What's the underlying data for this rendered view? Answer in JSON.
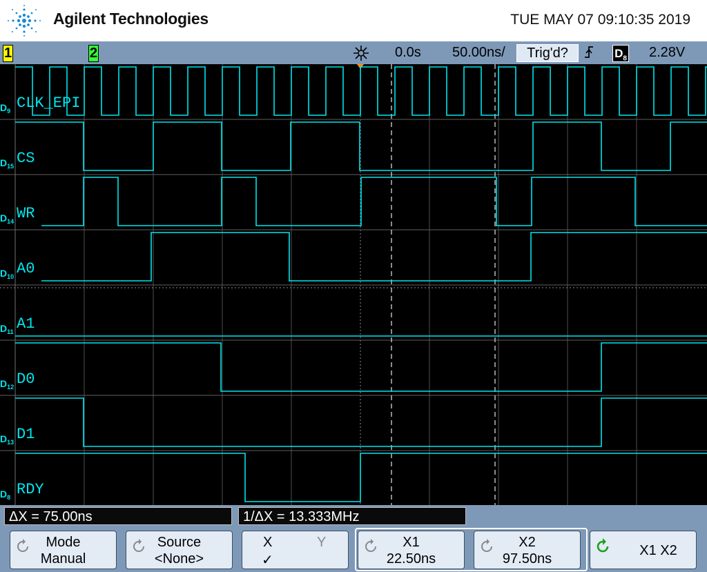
{
  "header": {
    "brand": "Agilent Technologies",
    "datetime": "TUE MAY 07 09:10:35 2019"
  },
  "statusbar": {
    "ch1": "1",
    "ch2": "2",
    "time_ref": "0.0s",
    "timebase": "50.00ns/",
    "trigger_state": "Trig'd?",
    "trigger_channel": "D",
    "trigger_channel_sub": "8",
    "trigger_level": "2.28V"
  },
  "channels": [
    {
      "label": "CLK_EPI",
      "ch": "D",
      "num": "9"
    },
    {
      "label": "CS",
      "ch": "D",
      "num": "15"
    },
    {
      "label": "WR",
      "ch": "D",
      "num": "14"
    },
    {
      "label": "A0",
      "ch": "D",
      "num": "10"
    },
    {
      "label": "A1",
      "ch": "D",
      "num": "11"
    },
    {
      "label": "D0",
      "ch": "D",
      "num": "12"
    },
    {
      "label": "D1",
      "ch": "D",
      "num": "13"
    },
    {
      "label": "RDY",
      "ch": "D",
      "num": "8"
    }
  ],
  "measurements": {
    "delta_x": "ΔX = 75.00ns",
    "inv_delta_x": "1/ΔX = 13.333MHz"
  },
  "softkeys": {
    "mode_title": "Mode",
    "mode_value": "Manual",
    "source_title": "Source",
    "source_value": "<None>",
    "x_label": "X",
    "y_label": "Y",
    "xy_check": "✓",
    "x1_title": "X1",
    "x1_value": "22.50ns",
    "x2_title": "X2",
    "x2_value": "97.50ns",
    "x1x2_label": "X1 X2"
  },
  "colors": {
    "trace": "#00e6ee",
    "grid": "#555555",
    "background": "#000000",
    "frame": "#7e99b8"
  }
}
